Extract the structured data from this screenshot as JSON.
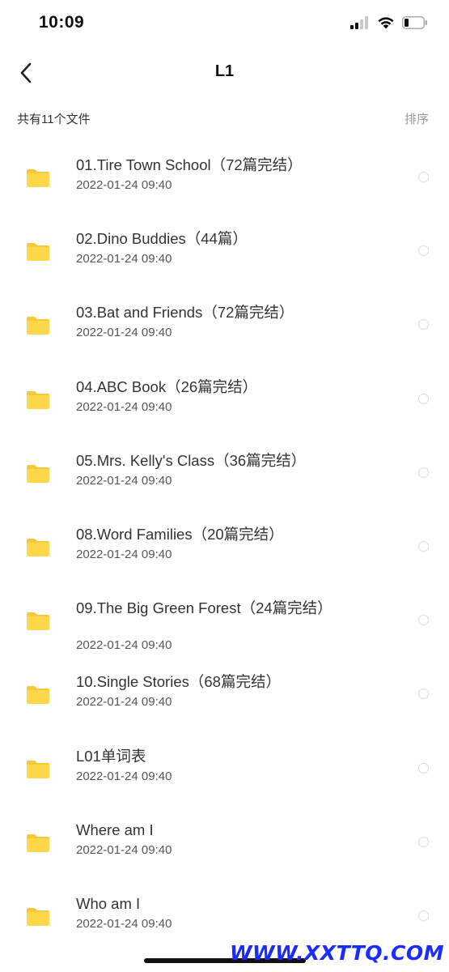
{
  "status_bar": {
    "time": "10:09"
  },
  "nav": {
    "title": "L1",
    "back_icon": "chevron-left-icon"
  },
  "summary": {
    "count_label": "共有11个文件",
    "sort_label": "排序"
  },
  "colors": {
    "folder": "#ffd84a",
    "folder_tab": "#f7c83a",
    "radio_border": "#dcdcdc",
    "watermark": "#1a2cff"
  },
  "files": [
    {
      "name": "01.Tire Town School（72篇完结）",
      "date": "2022-01-24 09:40",
      "icon": "folder-icon"
    },
    {
      "name": "02.Dino Buddies（44篇）",
      "date": "2022-01-24 09:40",
      "icon": "folder-icon"
    },
    {
      "name": "03.Bat and Friends（72篇完结）",
      "date": "2022-01-24 09:40",
      "icon": "folder-icon"
    },
    {
      "name": "04.ABC Book（26篇完结）",
      "date": "2022-01-24 09:40",
      "icon": "folder-icon"
    },
    {
      "name": "05.Mrs. Kelly's Class（36篇完结）",
      "date": "2022-01-24 09:40",
      "icon": "folder-icon"
    },
    {
      "name": "08.Word Families（20篇完结）",
      "date": "2022-01-24 09:40",
      "icon": "folder-icon"
    },
    {
      "name": "09.The Big Green Forest（24篇完结）",
      "date": "2022-01-24 09:40",
      "icon": "folder-icon"
    },
    {
      "name": "10.Single Stories（68篇完结）",
      "date": "2022-01-24 09:40",
      "icon": "folder-icon"
    },
    {
      "name": "L01单词表",
      "date": "2022-01-24 09:40",
      "icon": "folder-icon"
    },
    {
      "name": "Where am I",
      "date": "2022-01-24 09:40",
      "icon": "folder-icon"
    },
    {
      "name": "Who am I",
      "date": "2022-01-24 09:40",
      "icon": "folder-icon"
    }
  ],
  "watermark": "WWW.XXTTQ.COM"
}
